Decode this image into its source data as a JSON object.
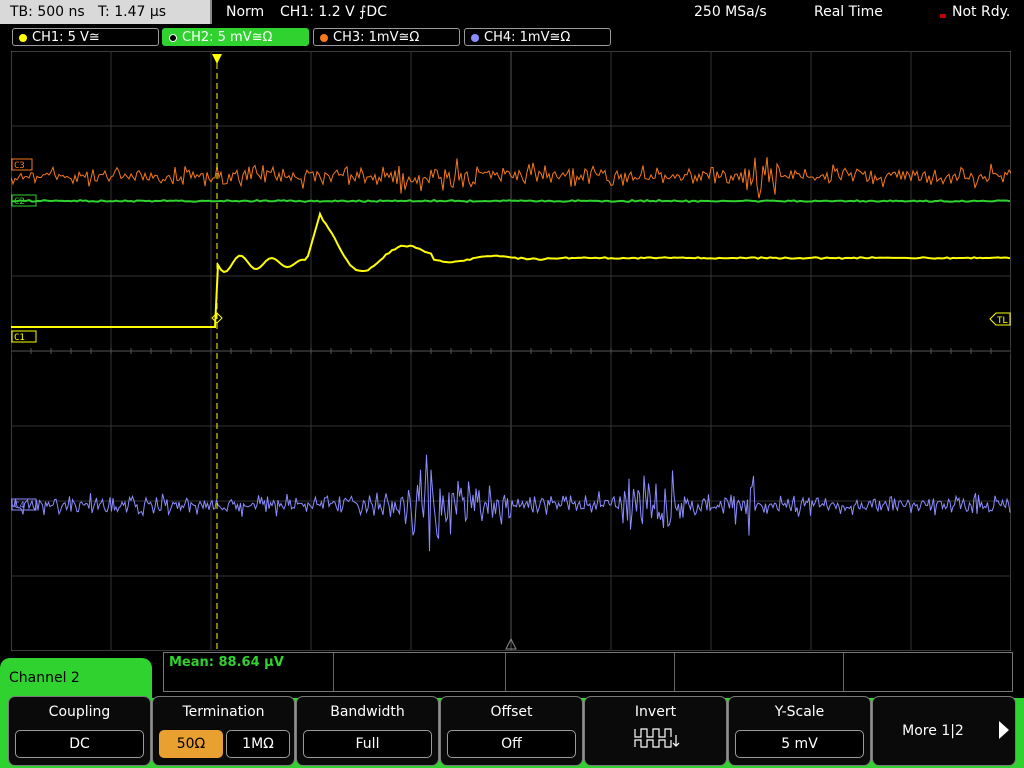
{
  "status": {
    "timebase": "TB: 500 ns",
    "trigger_time": "T: 1.47 µs",
    "mode": "Norm",
    "trigger": "CH1: 1.2 V ⨍DC",
    "sample_rate": "250 MSa/s",
    "acquisition": "Real Time",
    "state": "Not Rdy."
  },
  "channel_tabs": [
    {
      "label": "CH1: 5 V≅",
      "color": "#ffff00"
    },
    {
      "label": "CH2: 5 mV≅Ω",
      "color": "#2fd22f"
    },
    {
      "label": "CH3: 1mV≅Ω",
      "color": "#f5781e"
    },
    {
      "label": "CH4: 1mV≅Ω",
      "color": "#8c8cff"
    }
  ],
  "plot_markers": {
    "ch3": "C3",
    "ch2": "C2",
    "ch1": "C1",
    "ch4": "C4",
    "trigger_level": "TL"
  },
  "colors": {
    "ch1": "#ffff00",
    "ch2": "#2fd22f",
    "ch3": "#f5781e",
    "ch4": "#8c8cff",
    "grid": "#3a3a3a"
  },
  "measurement": {
    "mean": "Mean: 88.64 µV"
  },
  "menu": {
    "title": "Channel 2",
    "coupling_title": "Coupling",
    "coupling_value": "DC",
    "termination_title": "Termination",
    "termination_50": "50Ω",
    "termination_1m": "1MΩ",
    "bandwidth_title": "Bandwidth",
    "bandwidth_value": "Full",
    "offset_title": "Offset",
    "offset_value": "Off",
    "invert_title": "Invert",
    "invert_icon": "square-wave-invert-icon",
    "yscale_title": "Y-Scale",
    "yscale_value": "5 mV",
    "more_label": "More 1|2"
  }
}
